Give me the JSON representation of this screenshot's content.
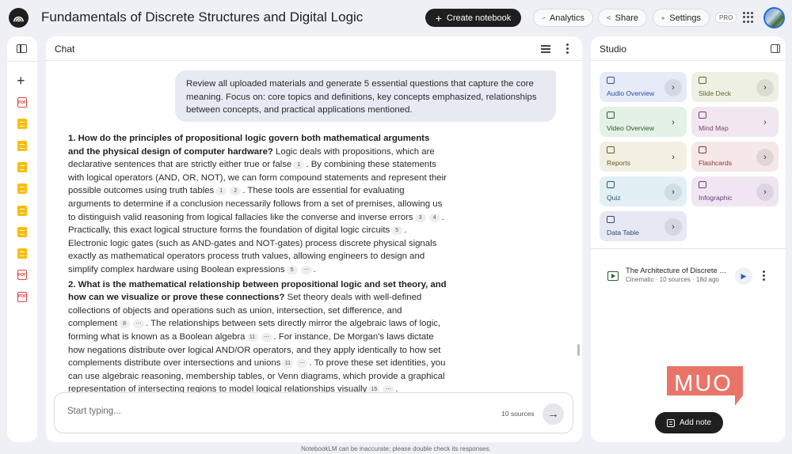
{
  "header": {
    "notebook_title": "Fundamentals of Discrete Structures and Digital Logic",
    "create_label": "Create notebook",
    "analytics_label": "Analytics",
    "share_label": "Share",
    "settings_label": "Settings",
    "plan_badge": "PRO"
  },
  "sources_rail": {
    "icons": [
      "pdf",
      "doc",
      "doc",
      "doc",
      "doc",
      "doc",
      "doc",
      "doc",
      "pdf",
      "pdf"
    ]
  },
  "chat": {
    "title": "Chat",
    "user_message": "Review all uploaded materials and generate 5 essential questions that capture the core meaning. Focus on: core topics and definitions, key concepts emphasized, relationships between concepts, and practical applications mentioned.",
    "answer": [
      {
        "question": "1. How do the principles of propositional logic govern both mathematical arguments and the physical design of computer hardware?",
        "segments": [
          {
            "text": " Logic deals with propositions, which are declarative sentences that are strictly either true or false",
            "cites": [
              "1"
            ]
          },
          {
            "text": ". By combining these statements with logical operators (AND, OR, NOT), we can form compound statements and represent their possible outcomes using truth tables",
            "cites": [
              "1",
              "2"
            ]
          },
          {
            "text": ". These tools are essential for evaluating arguments to determine if a conclusion necessarily follows from a set of premises, allowing us to distinguish valid reasoning from logical fallacies like the converse and inverse errors",
            "cites": [
              "3",
              "4"
            ]
          },
          {
            "text": ". Practically, this exact logical structure forms the foundation of digital logic circuits",
            "cites": [
              "5"
            ]
          },
          {
            "text": ". Electronic logic gates (such as AND-gates and NOT-gates) process discrete physical signals exactly as mathematical operators process truth values, allowing engineers to design and simplify complex hardware using Boolean expressions",
            "cites": [
              "5",
              "⋯"
            ]
          },
          {
            "text": ".",
            "cites": []
          }
        ]
      },
      {
        "question": "2. What is the mathematical relationship between propositional logic and set theory, and how can we visualize or prove these connections?",
        "segments": [
          {
            "text": " Set theory deals with well-defined collections of objects and operations such as union, intersection, set difference, and complement",
            "cites": [
              "8",
              "⋯"
            ]
          },
          {
            "text": ". The relationships between sets directly mirror the algebraic laws of logic, forming what is known as a Boolean algebra",
            "cites": [
              "11",
              "⋯"
            ]
          },
          {
            "text": ". For instance, De Morgan's laws dictate how negations distribute over logical AND/OR operators, and they apply identically to how set complements distribute over intersections and unions",
            "cites": [
              "11",
              "⋯"
            ]
          },
          {
            "text": ". To prove these set identities, you can use algebraic reasoning, membership tables, or Venn diagrams, which provide a graphical representation of intersecting regions to model logical relationships visually",
            "cites": [
              "15",
              "⋯"
            ]
          },
          {
            "text": ".",
            "cites": []
          }
        ]
      }
    ],
    "input_placeholder": "Start typing...",
    "source_count": "10 sources",
    "disclaimer": "NotebookLM can be inaccurate; please double check its responses."
  },
  "studio": {
    "title": "Studio",
    "tiles": [
      {
        "label": "Audio Overview",
        "icon": "audio-icon",
        "bg": "#e6ebf7",
        "fg": "#2f4a9e",
        "arrow_bg": true
      },
      {
        "label": "Slide Deck",
        "icon": "slides-icon",
        "bg": "#eef0e4",
        "fg": "#5d6b2a",
        "arrow_bg": true
      },
      {
        "label": "Video Overview",
        "icon": "video-icon",
        "bg": "#e4f1e6",
        "fg": "#2c5d2e",
        "arrow_bg": false
      },
      {
        "label": "Mind Map",
        "icon": "mindmap-icon",
        "bg": "#f1e7f0",
        "fg": "#7a3f72",
        "arrow_bg": false
      },
      {
        "label": "Reports",
        "icon": "reports-icon",
        "bg": "#f3efe2",
        "fg": "#6b5a2a",
        "arrow_bg": false
      },
      {
        "label": "Flashcards",
        "icon": "flashcards-icon",
        "bg": "#f6e8e8",
        "fg": "#8a3434",
        "arrow_bg": true
      },
      {
        "label": "Quiz",
        "icon": "quiz-icon",
        "bg": "#e2f0f6",
        "fg": "#245b73",
        "arrow_bg": true
      },
      {
        "label": "Infographic",
        "icon": "infographic-icon",
        "bg": "#efe6f2",
        "fg": "#6a3b7e",
        "arrow_bg": true
      },
      {
        "label": "Data Table",
        "icon": "table-icon",
        "bg": "#e6e9f3",
        "fg": "#34437a",
        "arrow_bg": true
      }
    ],
    "artifact": {
      "title": "The Architecture of Discrete Structures",
      "meta": "Cinematic · 10 sources · 18d ago"
    },
    "add_note_label": "Add note"
  },
  "watermark": {
    "text": "MUO",
    "color": "#e9756a"
  }
}
